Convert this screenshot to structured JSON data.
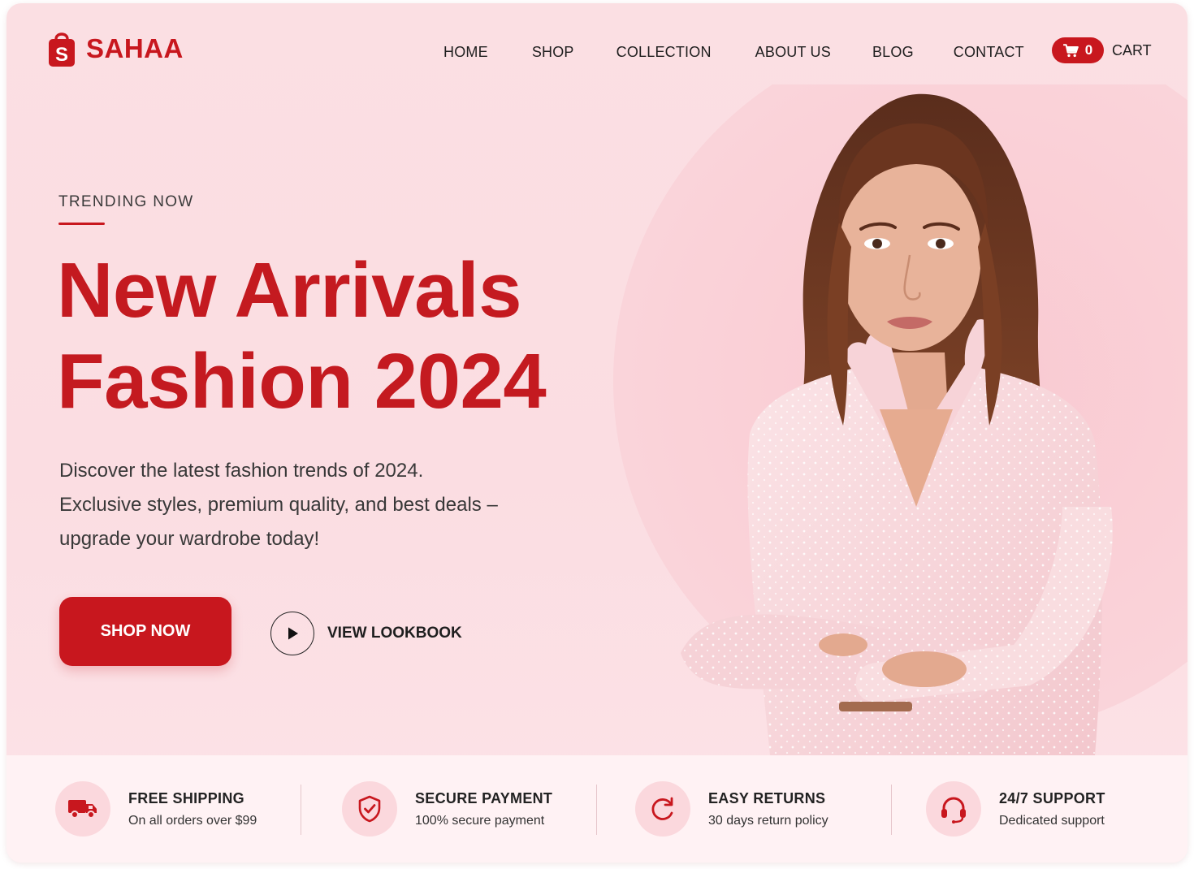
{
  "brand": {
    "name": "SAHAA",
    "logo_letter": "S"
  },
  "nav": {
    "items": [
      "HOME",
      "SHOP",
      "COLLECTION",
      "ABOUT US",
      "BLOG",
      "CONTACT"
    ]
  },
  "cart": {
    "count": "0",
    "label": "CART",
    "icon": "cart-icon"
  },
  "hero": {
    "eyebrow": "TRENDING NOW",
    "headline_line1": "New Arrivals",
    "headline_line2": "Fashion 2024",
    "description_lines": [
      "Discover the latest fashion trends of 2024.",
      "Exclusive styles, premium quality, and best deals –",
      "upgrade your wardrobe today!"
    ],
    "primary_button": "SHOP NOW",
    "secondary_button": "VIEW LOOKBOOK"
  },
  "features": [
    {
      "title": "FREE SHIPPING",
      "subtitle": "On all orders over $99",
      "icon": "truck-icon"
    },
    {
      "title": "SECURE PAYMENT",
      "subtitle": "100% secure payment",
      "icon": "shield-check-icon"
    },
    {
      "title": "EASY RETURNS",
      "subtitle": "30 days return policy",
      "icon": "refresh-icon"
    },
    {
      "title": "24/7 SUPPORT",
      "subtitle": "Dedicated support",
      "icon": "headset-icon"
    }
  ],
  "colors": {
    "accent": "#c8171e",
    "background": "#fbdde2",
    "feature_bar": "#fff2f4",
    "icon_circle": "#fbd8dd"
  }
}
